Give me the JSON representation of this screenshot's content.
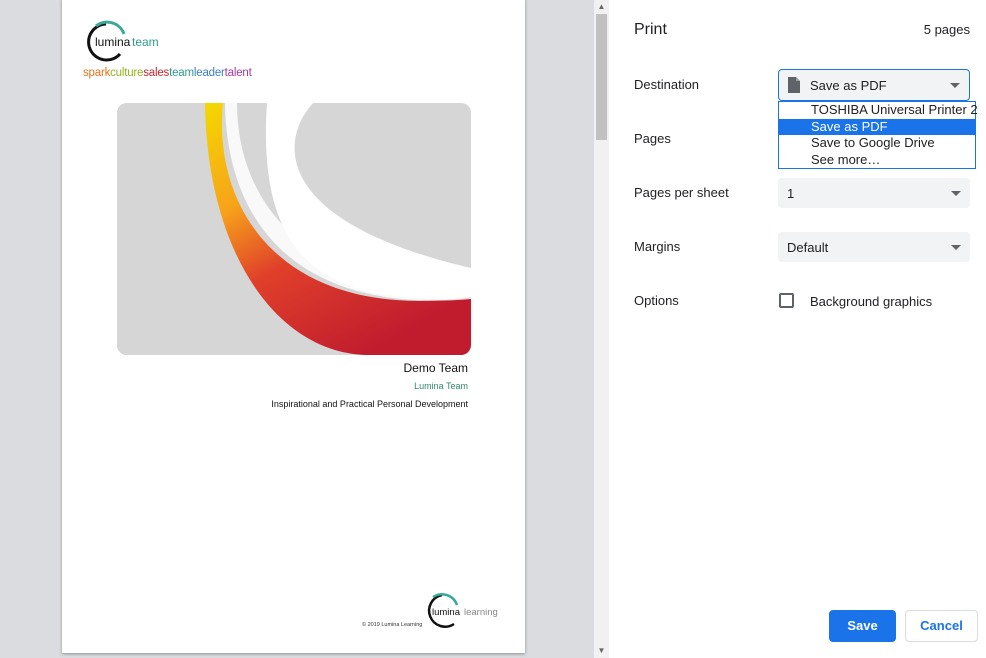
{
  "preview": {
    "logo_top_text": "luminateam",
    "tagline": [
      {
        "text": "spark",
        "color": "#e8731c"
      },
      {
        "text": "culture",
        "color": "#93b61c"
      },
      {
        "text": "sales",
        "color": "#c1272d"
      },
      {
        "text": "team",
        "color": "#2e9b8f"
      },
      {
        "text": "leader",
        "color": "#3a80c1"
      },
      {
        "text": "talent",
        "color": "#a33a9c"
      }
    ],
    "doc_title": "Demo Team",
    "doc_subtitle": "Lumina Team",
    "doc_desc": "Inspirational and Practical Personal Development",
    "logo_bottom_text": "luminalearning",
    "copyright": "© 2019 Lumina Learning"
  },
  "panel": {
    "title": "Print",
    "page_count": "5 pages",
    "destination": {
      "label": "Destination",
      "value": "Save as PDF",
      "options": [
        {
          "label": "TOSHIBA Universal Printer 2",
          "selected": false
        },
        {
          "label": "Save as PDF",
          "selected": true
        },
        {
          "label": "Save to Google Drive",
          "selected": false
        },
        {
          "label": "See more…",
          "selected": false
        }
      ]
    },
    "pages": {
      "label": "Pages"
    },
    "pages_per_sheet": {
      "label": "Pages per sheet",
      "value": "1"
    },
    "margins": {
      "label": "Margins",
      "value": "Default"
    },
    "options": {
      "label": "Options",
      "background_graphics": "Background graphics",
      "checked": false
    },
    "save_label": "Save",
    "cancel_label": "Cancel"
  },
  "colors": {
    "accent": "#1a73e8",
    "teal": "#2e8b6a"
  }
}
